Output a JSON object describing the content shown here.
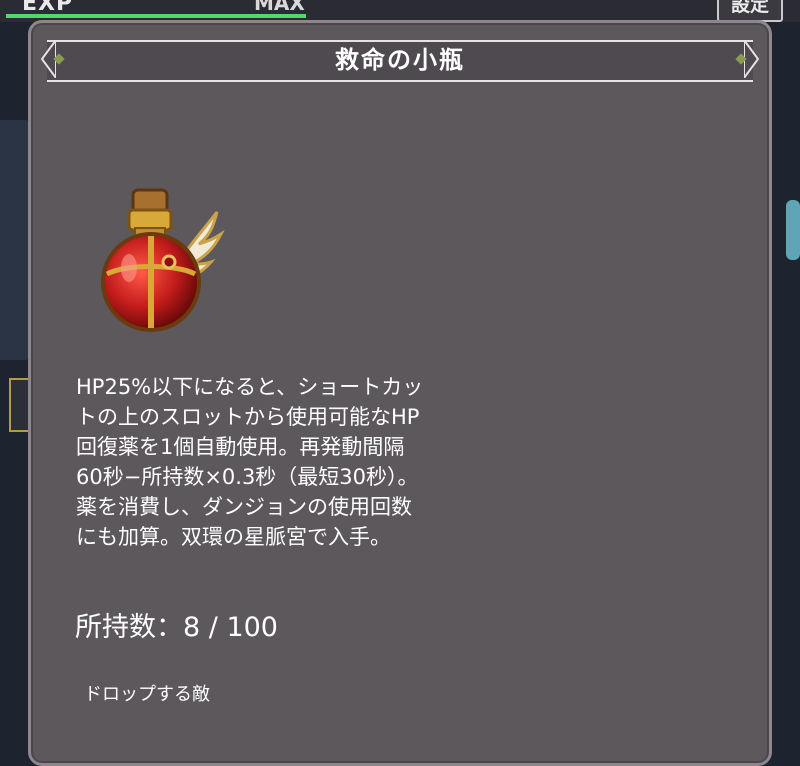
{
  "hud": {
    "exp_label": "EXP",
    "max_label": "MAX",
    "exp_fill": 1.0,
    "settings_label": "設定"
  },
  "item": {
    "name": "救命の小瓶",
    "icon": "winged-red-potion-icon",
    "description_lines": [
      "HP25%以下になると、ショートカッ",
      "トの上のスロットから使用可能なHP",
      "回復薬を1個自動使用。再発動間隔",
      "60秒−所持数×0.3秒（最短30秒）。",
      "薬を消費し、ダンジョンの使用回数",
      "にも加算。双環の星脈宮で入手。"
    ],
    "owned_label": "所持数：",
    "owned_count": "8",
    "owned_separator": " / ",
    "owned_max": "100",
    "drop_enemies_label": "ドロップする敵"
  },
  "colors": {
    "panel": "#5c585c",
    "title_bar": "#4f4a4f",
    "text": "#ffffff",
    "exp_bar": "#53d86a",
    "potion_red": "#c41c1c",
    "gold": "#d8a838"
  }
}
